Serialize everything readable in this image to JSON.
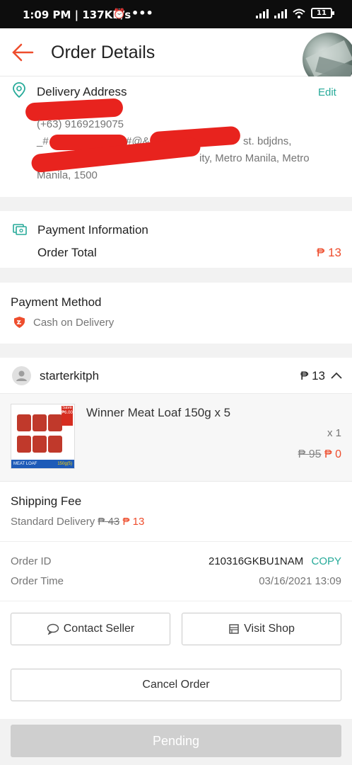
{
  "status_bar": {
    "time": "1:09 PM | 137KB/s",
    "icons": [
      "alarm-icon",
      "more-icon",
      "signal-icon",
      "signal-icon",
      "wifi-icon"
    ],
    "battery": "11"
  },
  "header": {
    "title": "Order Details"
  },
  "delivery": {
    "label": "Delivery Address",
    "edit": "Edit",
    "phone": "(+63) 9169219075",
    "line1_start": "_#",
    "line1_mid": "#@&",
    "line1_end": "st. bdjdns,",
    "line2": "ity, Metro Manila, Metro",
    "line3": "Manila, 1500"
  },
  "payment_info": {
    "label": "Payment Information",
    "order_total_label": "Order Total",
    "order_total": "₱ 13"
  },
  "payment_method": {
    "label": "Payment Method",
    "value": "Cash on Delivery"
  },
  "shop": {
    "name": "starterkitph",
    "total": "₱ 13"
  },
  "product": {
    "name": "Winner Meat Loaf 150g x 5",
    "qty": "x 1",
    "original_price": "₱ 95",
    "price": "₱ 0",
    "image_badge": "Save ₱6.00",
    "image_brand": "MEAT LOAF",
    "image_size": "150g(5)"
  },
  "shipping": {
    "label": "Shipping Fee",
    "method": "Standard Delivery",
    "original_fee": "₱ 43",
    "fee": "₱ 13"
  },
  "order": {
    "id_label": "Order ID",
    "id": "210316GKBU1NAM",
    "copy": "COPY",
    "time_label": "Order Time",
    "time": "03/16/2021 13:09"
  },
  "actions": {
    "contact_seller": "Contact Seller",
    "visit_shop": "Visit Shop",
    "cancel": "Cancel Order",
    "pending": "Pending"
  },
  "colors": {
    "accent": "#ee4d2d",
    "teal": "#26aa99",
    "redaction": "#e8231e"
  }
}
